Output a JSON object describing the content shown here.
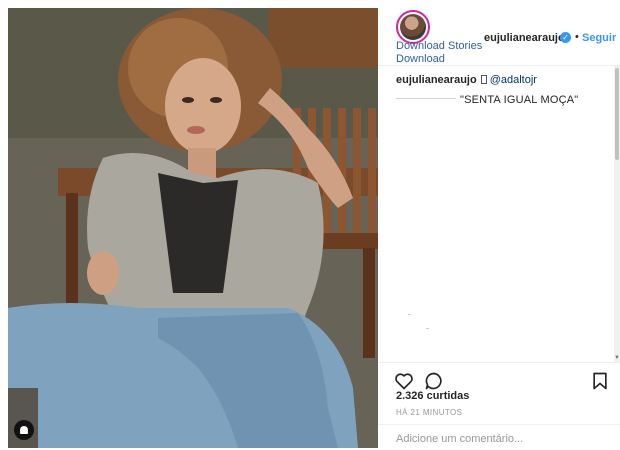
{
  "photo": {
    "alt_icon": "person-tag-icon"
  },
  "header": {
    "avatar_icon": "profile-avatar",
    "download_stories_label": "Download Stories",
    "download_label": "Download",
    "username": "eujulianearaujo",
    "verified_icon": "verified-check-icon",
    "separator": "•",
    "follow_label": "Seguir"
  },
  "caption": {
    "username": "eujulianearaujo",
    "mention": "@adaltojr",
    "text": "\"SENTA IGUAL MOÇA\""
  },
  "actions": {
    "like_icon": "heart-icon",
    "comment_icon": "comment-bubble-icon",
    "save_icon": "bookmark-icon"
  },
  "stats": {
    "likes": "2.326 curtidas",
    "time": "HÁ 21 MINUTOS"
  },
  "comment": {
    "placeholder": "Adicione um comentário..."
  },
  "colors": {
    "link_blue": "#2f5fa8",
    "follow_blue": "#3897f0",
    "story_ring": "#d6249f"
  }
}
